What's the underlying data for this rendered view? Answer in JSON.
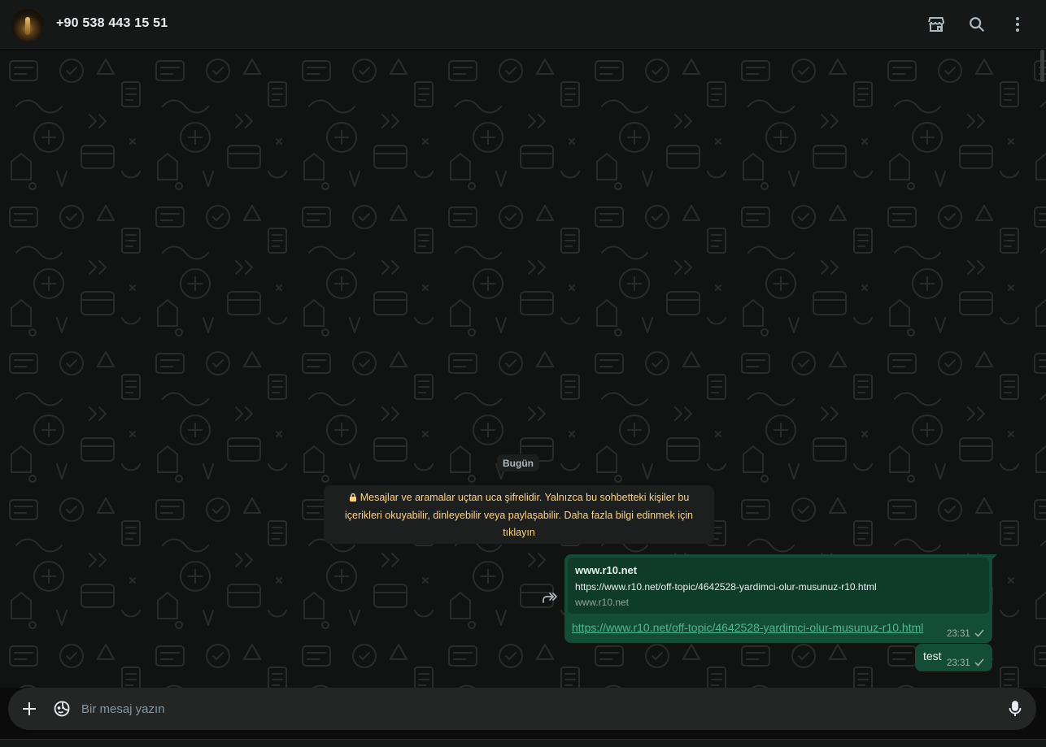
{
  "header": {
    "contact_name": "+90 538 443 15 51",
    "icons": [
      "catalog-icon",
      "search-icon",
      "menu-icon"
    ]
  },
  "chat": {
    "date_divider": "Bugün",
    "e2e_notice": "Mesajlar ve aramalar uçtan uca şifrelidir. Yalnızca bu sohbetteki kişiler bu içerikleri okuyabilir, dinleyebilir veya paylaşabilir. Daha fazla bilgi edinmek için tıklayın",
    "messages": [
      {
        "type": "link",
        "preview_title": "www.r10.net",
        "preview_description": "https://www.r10.net/off-topic/4642528-yardimci-olur-musunuz-r10.html",
        "preview_domain": "www.r10.net",
        "link_text": "https://www.r10.net/off-topic/4642528-yardimci-olur-musunuz-r10.html",
        "time": "23:31",
        "status": "sent"
      },
      {
        "type": "text",
        "text": "test",
        "time": "23:31",
        "status": "sent"
      }
    ]
  },
  "composer": {
    "placeholder": "Bir mesaj yazın"
  },
  "colors": {
    "header_bg": "#161717",
    "chat_bg": "#111212",
    "outgoing_bubble": "#144d37",
    "link_color": "#4fb88d",
    "notice_text": "#ffd279"
  }
}
